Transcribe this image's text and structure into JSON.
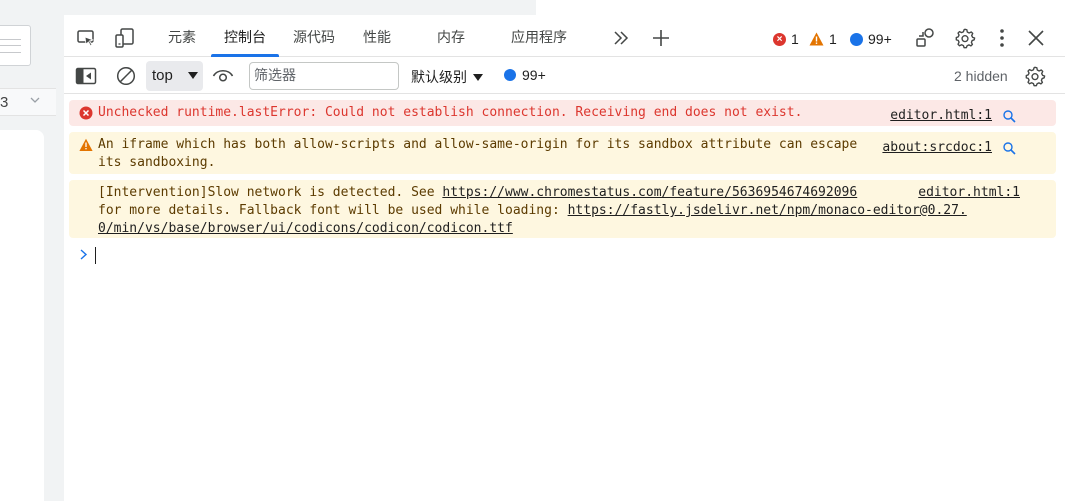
{
  "left": {
    "fragment_text": "3"
  },
  "tabs": [
    {
      "label": "元素",
      "active": false
    },
    {
      "label": "控制台",
      "active": true
    },
    {
      "label": "源代码",
      "active": false
    },
    {
      "label": "性能",
      "active": false
    },
    {
      "label": "内存",
      "active": false
    },
    {
      "label": "应用程序",
      "active": false
    }
  ],
  "status": {
    "errors": "1",
    "warnings": "1",
    "messages": "99+"
  },
  "toolbar": {
    "context": "top",
    "filter_placeholder": "筛选器",
    "levels": "默认级别",
    "messages": "99+",
    "hidden": "2 hidden"
  },
  "console": {
    "messages": [
      {
        "level": "error",
        "text": "Unchecked runtime.lastError: Could not establish connection. Receiving end does not exist.",
        "source": "editor.html:1"
      },
      {
        "level": "warning",
        "text": "An iframe which has both allow-scripts and allow-same-origin for its sandbox attribute can escape its sandboxing.",
        "source": "about:srcdoc:1"
      },
      {
        "level": "info",
        "text_before": "[Intervention]Slow network is detected. See ",
        "link1": "https://www.chromestatus.com/feature/5636954674692096",
        "text_mid": "for more details. Fallback font will be used while loading: ",
        "link2_line1": "https://fastly.jsdelivr.net/npm/monaco-editor@0.27.",
        "link2_line2": "0/min/vs/base/browser/ui/codicons/codicon/codicon.ttf",
        "source": "editor.html:1"
      }
    ]
  },
  "colors": {
    "accent": "#1a73e8",
    "error": "#dc362e",
    "warning": "#e37400",
    "error_bg": "#fce8e6",
    "warning_bg": "#fef7e0"
  }
}
